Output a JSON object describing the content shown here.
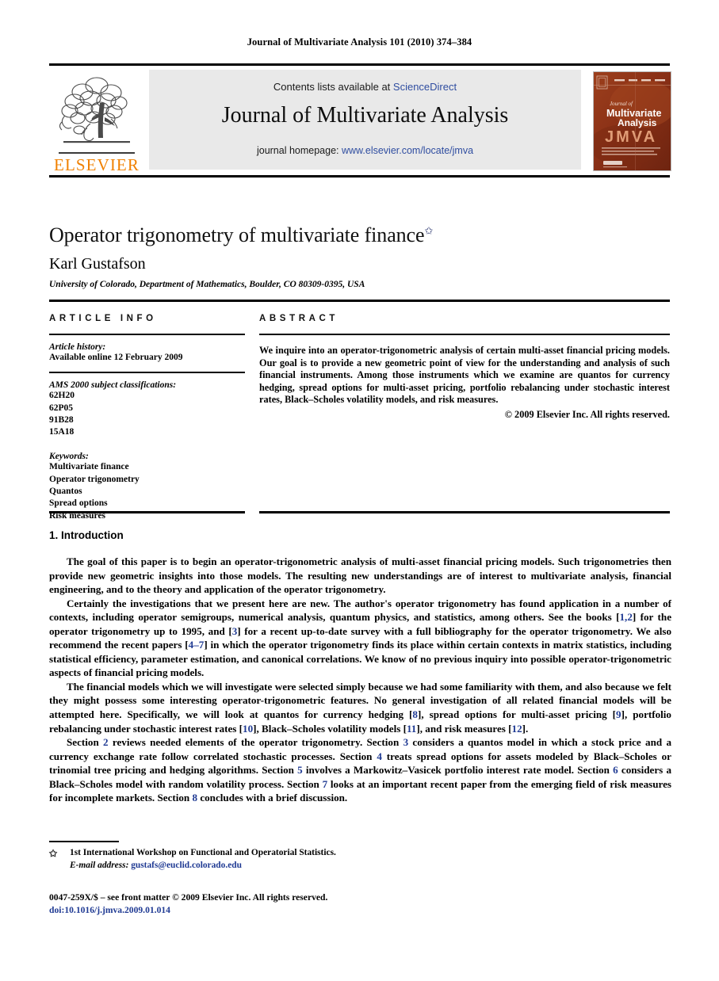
{
  "running_head": "Journal of Multivariate Analysis 101 (2010) 374–384",
  "masthead": {
    "contents_prefix": "Contents lists available at ",
    "sciencedirect": "ScienceDirect",
    "journal_title": "Journal of Multivariate Analysis",
    "homepage_prefix": "journal homepage: ",
    "homepage_url": "www.elsevier.com/locate/jmva",
    "publisher_wordmark": "ELSEVIER",
    "cover": {
      "line1": "Journal of",
      "line2": "Multivariate",
      "line3": "Analysis",
      "acronym": "JMVA"
    }
  },
  "article": {
    "title": "Operator trigonometry of multivariate finance",
    "title_footnote_marker": "✩",
    "author": "Karl Gustafson",
    "affiliation": "University of Colorado, Department of Mathematics, Boulder, CO 80309-0395, USA"
  },
  "info": {
    "heading": "ARTICLE INFO",
    "history_label": "Article history:",
    "history_value": "Available online 12 February 2009",
    "msc_label": "AMS 2000 subject classifications:",
    "msc_codes": [
      "62H20",
      "62P05",
      "91B28",
      "15A18"
    ],
    "keywords_label": "Keywords:",
    "keywords": [
      "Multivariate finance",
      "Operator trigonometry",
      "Quantos",
      "Spread options",
      "Risk measures"
    ]
  },
  "abstract": {
    "heading": "ABSTRACT",
    "body": "We inquire into an operator-trigonometric analysis of certain multi-asset financial pricing models. Our goal is to provide a new geometric point of view for the understanding and analysis of such financial instruments. Among those instruments which we examine are quantos for currency hedging, spread options for multi-asset pricing, portfolio rebalancing under stochastic interest rates, Black–Scholes volatility models, and risk measures.",
    "copyright": "© 2009 Elsevier Inc. All rights reserved."
  },
  "section": {
    "number_and_title": "1. Introduction",
    "paragraphs": [
      "The goal of this paper is to begin an operator-trigonometric analysis of multi-asset financial pricing models. Such trigonometries then provide new geometric insights into those models. The resulting new understandings are of interest to multivariate analysis, financial engineering, and to the theory and application of the operator trigonometry.",
      "Certainly the investigations that we present here are new. The author's operator trigonometry has found application in a number of contexts, including operator semigroups, numerical analysis, quantum physics, and statistics, among others. See the books [1,2] for the operator trigonometry up to 1995, and [3] for a recent up-to-date survey with a full bibliography for the operator trigonometry. We also recommend the recent papers [4–7] in which the operator trigonometry finds its place within certain contexts in matrix statistics, including statistical efficiency, parameter estimation, and canonical correlations. We know of no previous inquiry into possible operator-trigonometric aspects of financial pricing models.",
      "The financial models which we will investigate were selected simply because we had some familiarity with them, and also because we felt they might possess some interesting operator-trigonometric features. No general investigation of all related financial models will be attempted here. Specifically, we will look at quantos for currency hedging [8], spread options for multi-asset pricing [9], portfolio rebalancing under stochastic interest rates [10], Black–Scholes volatility models [11], and risk measures [12].",
      "Section 2 reviews needed elements of the operator trigonometry. Section 3 considers a quantos model in which a stock price and a currency exchange rate follow correlated stochastic processes. Section 4 treats spread options for assets modeled by Black–Scholes or trinomial tree pricing and hedging algorithms. Section 5 involves a Markowitz–Vasicek portfolio interest rate model. Section 6 considers a Black–Scholes model with random volatility process. Section 7 looks at an important recent paper from the emerging field of risk measures for incomplete markets. Section 8 concludes with a brief discussion."
    ]
  },
  "footnote": {
    "marker": "✩",
    "text": "1st International Workshop on Functional and Operatorial Statistics.",
    "email_label": "E-mail address:",
    "email": "gustafs@euclid.colorado.edu"
  },
  "colophon": {
    "front_matter": "0047-259X/$ – see front matter © 2009 Elsevier Inc. All rights reserved.",
    "doi": "doi:10.1016/j.jmva.2009.01.014"
  },
  "colors": {
    "link": "#2f4da0",
    "reference_link": "#1f3a93",
    "elsevier_orange": "#f08000",
    "banner_bg": "#e9e9e9",
    "cover_bg": "#8c3318"
  }
}
